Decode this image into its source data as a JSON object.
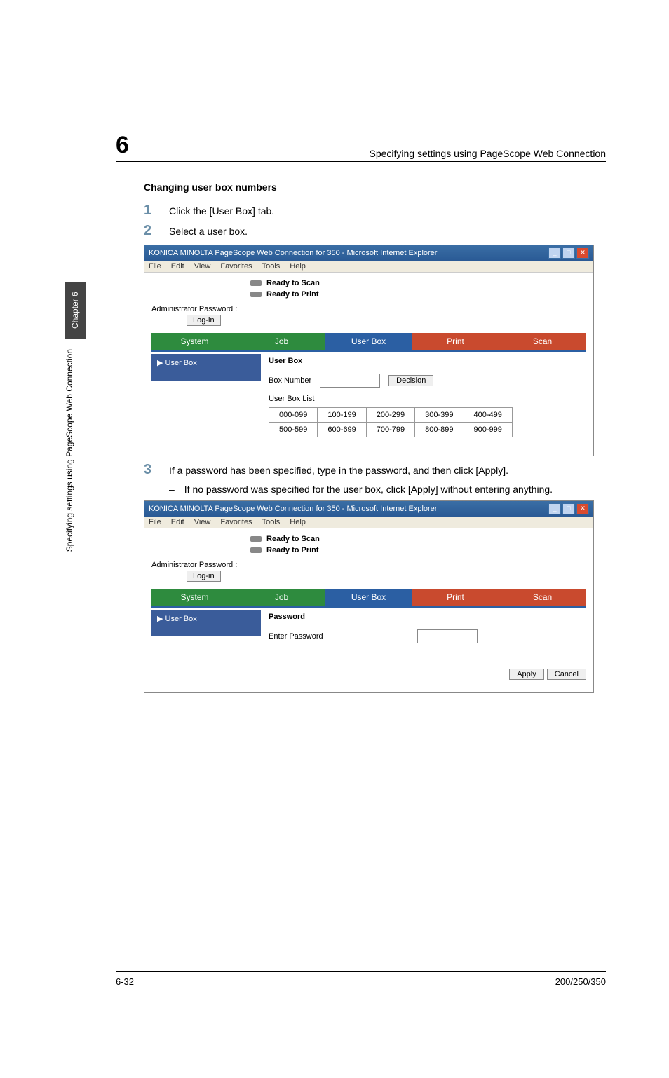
{
  "sidebar": {
    "chapter_tab": "Chapter 6",
    "vertical_text": "Specifying settings using PageScope Web Connection"
  },
  "header": {
    "num": "6",
    "title": "Specifying settings using PageScope Web Connection"
  },
  "section_title": "Changing user box numbers",
  "steps": {
    "s1": {
      "n": "1",
      "text": "Click the [User Box] tab."
    },
    "s2": {
      "n": "2",
      "text": "Select a user box."
    },
    "s3": {
      "n": "3",
      "text": "If a password has been specified, type in the password, and then click [Apply]."
    },
    "s3sub": {
      "dash": "–",
      "text": "If no password was specified for the user box, click [Apply] without entering anything."
    }
  },
  "ie": {
    "title": "KONICA MINOLTA PageScope Web Connection for 350 - Microsoft Internet Explorer",
    "menu": {
      "file": "File",
      "edit": "Edit",
      "view": "View",
      "favorites": "Favorites",
      "tools": "Tools",
      "help": "Help"
    },
    "status1": "Ready to Scan",
    "status2": "Ready to Print",
    "admin_label": "Administrator Password :",
    "login": "Log-in",
    "tabs": {
      "system": "System",
      "job": "Job",
      "userbox": "User Box",
      "print": "Print",
      "scan": "Scan"
    },
    "side_item": "▶ User Box"
  },
  "ss1": {
    "panel_title": "User Box",
    "boxnum_label": "Box Number",
    "decision": "Decision",
    "list_label": "User Box List",
    "ranges": [
      [
        "000-099",
        "100-199",
        "200-299",
        "300-399",
        "400-499"
      ],
      [
        "500-599",
        "600-699",
        "700-799",
        "800-899",
        "900-999"
      ]
    ]
  },
  "ss2": {
    "panel_title": "Password",
    "enter_pw": "Enter Password",
    "apply": "Apply",
    "cancel": "Cancel"
  },
  "footer": {
    "left": "6-32",
    "right": "200/250/350"
  }
}
